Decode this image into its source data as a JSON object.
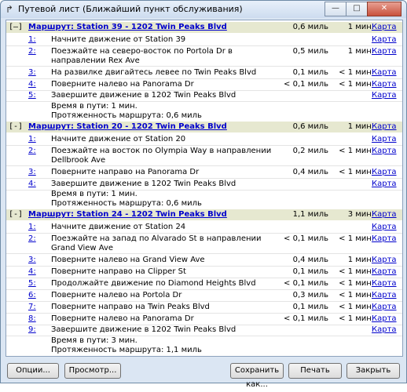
{
  "window": {
    "title": "Путевой лист (Ближайший пункт обслуживания)"
  },
  "routes": [
    {
      "toggle": "[–]",
      "title": "Маршрут: Station 39 - 1202 Twin Peaks Blvd",
      "distance": "0,6 миль",
      "time": "1 мин.",
      "map": "Карта",
      "steps": [
        {
          "n": "1:",
          "text": "Начните движение от Station 39",
          "dist": "",
          "time": "",
          "map": "Карта"
        },
        {
          "n": "2:",
          "text": "Поезжайте на северо-восток по Portola Dr в направлении Rex Ave",
          "dist": "0,5 миль",
          "time": "1 мин.",
          "map": "Карта"
        },
        {
          "n": "3:",
          "text": "На развилке двигайтесь левее по Twin Peaks Blvd",
          "dist": "0,1 миль",
          "time": "< 1 мин.",
          "map": "Карта"
        },
        {
          "n": "4:",
          "text": "Поверните налево на Panorama Dr",
          "dist": "< 0,1 миль",
          "time": "< 1 мин.",
          "map": "Карта"
        },
        {
          "n": "5:",
          "text": "Завершите движение в 1202 Twin Peaks Blvd",
          "dist": "",
          "time": "",
          "map": "Карта"
        }
      ],
      "travel_time": "Время в пути: 1 мин.",
      "length": "Протяженность маршрута: 0,6 миль"
    },
    {
      "toggle": "[-]",
      "title": "Маршрут: Station 20 - 1202 Twin Peaks Blvd",
      "distance": "0,6 миль",
      "time": "1 мин.",
      "map": "Карта",
      "steps": [
        {
          "n": "1:",
          "text": "Начните движение от Station 20",
          "dist": "",
          "time": "",
          "map": "Карта"
        },
        {
          "n": "2:",
          "text": "Поезжайте на восток по Olympia Way в направлении Dellbrook Ave",
          "dist": "0,2 миль",
          "time": "< 1 мин.",
          "map": "Карта"
        },
        {
          "n": "3:",
          "text": "Поверните направо на Panorama Dr",
          "dist": "0,4 миль",
          "time": "< 1 мин.",
          "map": "Карта"
        },
        {
          "n": "4:",
          "text": "Завершите движение в 1202 Twin Peaks Blvd",
          "dist": "",
          "time": "",
          "map": "Карта"
        }
      ],
      "travel_time": "Время в пути: 1 мин.",
      "length": "Протяженность маршрута: 0,6 миль"
    },
    {
      "toggle": "[-]",
      "title": "Маршрут: Station 24 - 1202 Twin Peaks Blvd",
      "distance": "1,1 миль",
      "time": "3 мин.",
      "map": "Карта",
      "steps": [
        {
          "n": "1:",
          "text": "Начните движение от Station 24",
          "dist": "",
          "time": "",
          "map": "Карта"
        },
        {
          "n": "2:",
          "text": "Поезжайте на запад по Alvarado St в направлении Grand View Ave",
          "dist": "< 0,1 миль",
          "time": "< 1 мин.",
          "map": "Карта"
        },
        {
          "n": "3:",
          "text": "Поверните налево на Grand View Ave",
          "dist": "0,4 миль",
          "time": "1 мин.",
          "map": "Карта"
        },
        {
          "n": "4:",
          "text": "Поверните направо на Clipper St",
          "dist": "0,1 миль",
          "time": "< 1 мин.",
          "map": "Карта"
        },
        {
          "n": "5:",
          "text": "Продолжайте движение по Diamond Heights Blvd",
          "dist": "< 0,1 миль",
          "time": "< 1 мин.",
          "map": "Карта"
        },
        {
          "n": "6:",
          "text": "Поверните налево на Portola Dr",
          "dist": "0,3 миль",
          "time": "< 1 мин.",
          "map": "Карта"
        },
        {
          "n": "7:",
          "text": "Поверните направо на Twin Peaks Blvd",
          "dist": "0,1 миль",
          "time": "< 1 мин.",
          "map": "Карта"
        },
        {
          "n": "8:",
          "text": "Поверните налево на Panorama Dr",
          "dist": "< 0,1 миль",
          "time": "< 1 мин.",
          "map": "Карта"
        },
        {
          "n": "9:",
          "text": "Завершите движение в 1202 Twin Peaks Blvd",
          "dist": "",
          "time": "",
          "map": "Карта"
        }
      ],
      "travel_time": "Время в пути: 3 мин.",
      "length": "Протяженность маршрута: 1,1 миль"
    }
  ],
  "buttons": {
    "options": "Опции...",
    "preview": "Просмотр...",
    "save_as": "Сохранить как...",
    "print": "Печать",
    "close": "Закрыть"
  }
}
